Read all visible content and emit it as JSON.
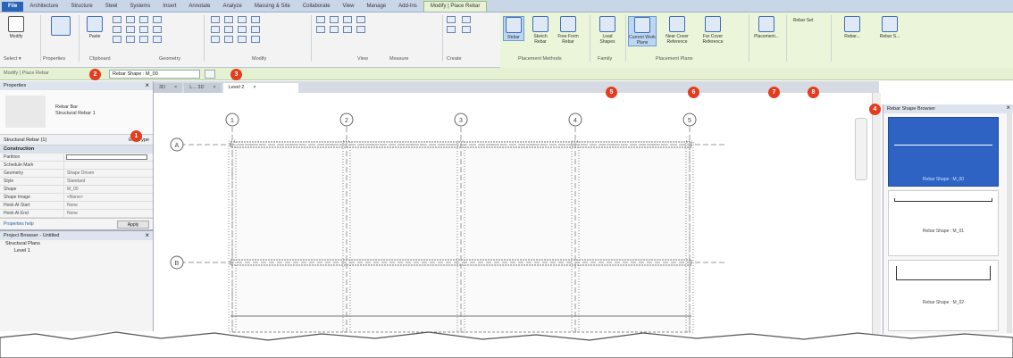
{
  "ribbon_tabs": [
    "File",
    "Architecture",
    "Structure",
    "Steel",
    "Systems",
    "Insert",
    "Annotate",
    "Analyze",
    "Massing & Site",
    "Collaborate",
    "View",
    "Manage",
    "Add-Ins",
    "Modify | Place Rebar"
  ],
  "active_tab_index": 13,
  "ribbon": {
    "tools": [
      {
        "label": "Modify"
      },
      {
        "label": "Paste"
      },
      {
        "label": "Rebar"
      },
      {
        "label": "Sketch Rebar"
      },
      {
        "label": "Free Form Rebar"
      },
      {
        "label": "Load Shapes"
      },
      {
        "label": "Current Work Plane"
      },
      {
        "label": "Near Cover Reference"
      },
      {
        "label": "Far Cover Reference"
      },
      {
        "label": "Placement..."
      },
      {
        "label": "Rebar Set"
      },
      {
        "label": "Rebar..."
      },
      {
        "label": "Rebar S..."
      }
    ],
    "groups": [
      "Select ▾",
      "Properties",
      "Clipboard",
      "Geometry",
      "Modify",
      "View",
      "Measure",
      "Create",
      "Placement Methods",
      "Family",
      "Placement Plane"
    ]
  },
  "options_bar": {
    "label": "Modify | Place Rebar",
    "shape_value": "Rebar Shape : M_00"
  },
  "badges": [
    "1",
    "2",
    "3",
    "4",
    "5",
    "6",
    "7",
    "8"
  ],
  "properties": {
    "title": "Properties",
    "type_name": "Rebar Bar",
    "type_sub": "Structural Rebar 1",
    "type_selector": "Structural Rebar (1)",
    "edit_type": "Edit Type",
    "category": "Construction",
    "rows": [
      {
        "k": "Partition",
        "v": ""
      },
      {
        "k": "Schedule Mark",
        "v": ""
      },
      {
        "k": "Geometry",
        "v": "Shape Driven"
      },
      {
        "k": "Style",
        "v": "Standard"
      },
      {
        "k": "Shape",
        "v": "M_00"
      },
      {
        "k": "Shape Image",
        "v": "<None>"
      },
      {
        "k": "Hook At Start",
        "v": "None"
      },
      {
        "k": "Hook At End",
        "v": "None"
      }
    ],
    "help_link": "Properties help",
    "apply": "Apply"
  },
  "project_browser": {
    "title": "Project Browser - Untitled",
    "items": [
      "Structural Plans",
      "Level 1"
    ]
  },
  "view_tabs": [
    {
      "label": "3D"
    },
    {
      "label": "L... 3D"
    },
    {
      "label": "Level 2",
      "active": true
    }
  ],
  "grid_bubbles_top": [
    "1",
    "2",
    "3",
    "4",
    "5"
  ],
  "grid_bubbles_left": [
    "A",
    "B"
  ],
  "rebar_browser": {
    "title": "Rebar Shape Browser",
    "shapes": [
      "Rebar Shape : M_00",
      "Rebar Shape : M_01",
      "Rebar Shape : M_02"
    ]
  },
  "colors": {
    "accent": "#2e63c4",
    "context_tab": "#e8f3d6",
    "badge": "#e43c1e"
  }
}
